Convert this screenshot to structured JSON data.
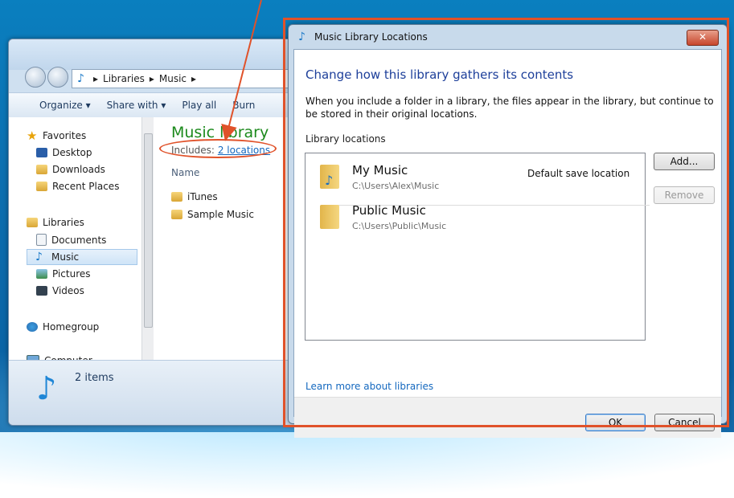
{
  "explorer": {
    "breadcrumb": [
      "Libraries",
      "Music"
    ],
    "commands": [
      "Organize ▾",
      "Share with ▾",
      "Play all",
      "Burn"
    ],
    "nav": {
      "favorites": "Favorites",
      "desktop": "Desktop",
      "downloads": "Downloads",
      "recent": "Recent Places",
      "libraries": "Libraries",
      "documents": "Documents",
      "music": "Music",
      "pictures": "Pictures",
      "videos": "Videos",
      "homegroup": "Homegroup",
      "computer": "Computer"
    },
    "library_title": "Music library",
    "includes_label": "Includes:",
    "includes_link": "2 locations",
    "column_name": "Name",
    "files": [
      "iTunes",
      "Sample Music"
    ],
    "status_count": "2 items"
  },
  "dialog": {
    "title": "Music Library Locations",
    "close": "✕",
    "heading": "Change how this library gathers its contents",
    "description": "When you include a folder in a library, the files appear in the library, but continue to be stored in their original locations.",
    "list_label": "Library locations",
    "locations": [
      {
        "name": "My Music",
        "path": "C:\\Users\\Alex\\Music",
        "note": "Default save location"
      },
      {
        "name": "Public Music",
        "path": "C:\\Users\\Public\\Music",
        "note": ""
      }
    ],
    "add_button": "Add...",
    "remove_button": "Remove",
    "learn_more": "Learn more about libraries",
    "ok_button": "OK",
    "cancel_button": "Cancel"
  },
  "colors": {
    "annotation": "#e0522a",
    "heading": "#1d3f9a",
    "library_title": "#1c8a1c",
    "link": "#1468bf"
  }
}
